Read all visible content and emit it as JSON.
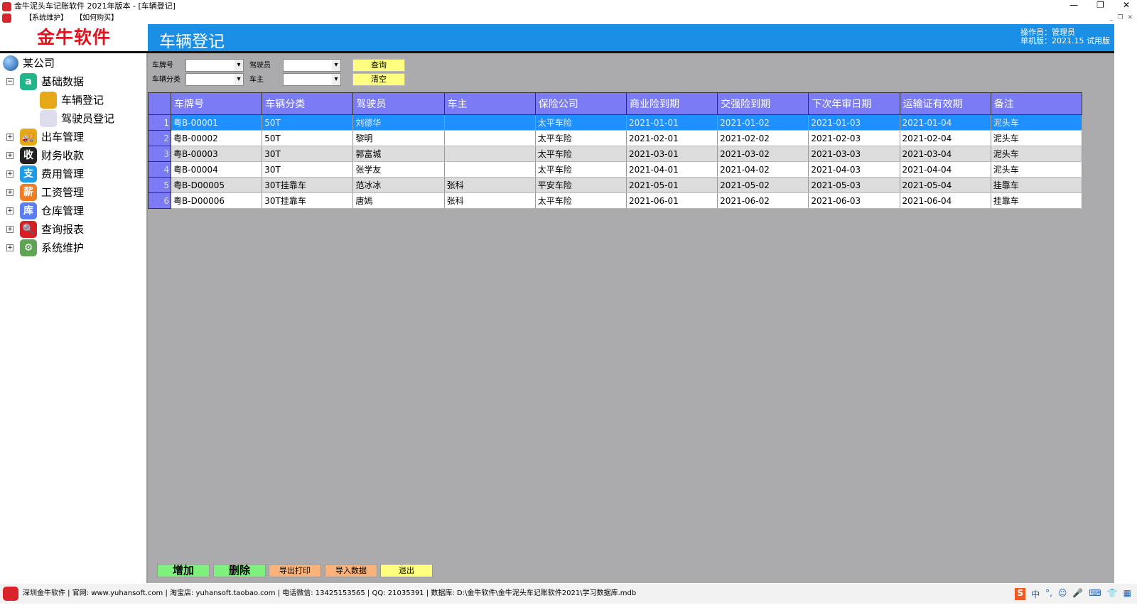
{
  "window": {
    "title": "金牛泥头车记账软件 2021年版本 - [车辆登记]",
    "controls": [
      "—",
      "❐",
      "✕"
    ],
    "mdi_controls": [
      "_",
      "❐",
      "✕"
    ]
  },
  "menu": [
    "【系统维护】",
    "【如何购买】"
  ],
  "logo": "金牛软件",
  "header": {
    "title": "车辆登记",
    "operator": "操作员：管理员",
    "version": "单机版：2021.15 试用版"
  },
  "sidebar": {
    "root": "某公司",
    "groups": [
      {
        "label": "基础数据",
        "expanded": true,
        "icon_text": "a",
        "color": "#20b58a",
        "children": [
          "车辆登记",
          "驾驶员登记"
        ]
      },
      {
        "label": "出车管理",
        "icon_text": "🚚",
        "color": "#e6a817"
      },
      {
        "label": "财务收款",
        "icon_text": "收",
        "color": "#222"
      },
      {
        "label": "费用管理",
        "icon_text": "支",
        "color": "#1e9be6"
      },
      {
        "label": "工资管理",
        "icon_text": "薪",
        "color": "#ef7d22"
      },
      {
        "label": "仓库管理",
        "icon_text": "库",
        "color": "#5b7ff2"
      },
      {
        "label": "查询报表",
        "icon_text": "🔍",
        "color": "#d71f26"
      },
      {
        "label": "系统维护",
        "icon_text": "⚙",
        "color": "#5ea454"
      }
    ]
  },
  "filters": {
    "plate": "车牌号",
    "category": "车辆分类",
    "driver": "驾驶员",
    "owner": "车主",
    "query": "查询",
    "clear": "清空"
  },
  "table": {
    "columns": [
      "车牌号",
      "车辆分类",
      "驾驶员",
      "车主",
      "保险公司",
      "商业险到期",
      "交强险到期",
      "下次年审日期",
      "运输证有效期",
      "备注"
    ],
    "rows": [
      [
        "1",
        "粤B-00001",
        "50T",
        "刘德华",
        "",
        "太平车险",
        "2021-01-01",
        "2021-01-02",
        "2021-01-03",
        "2021-01-04",
        "泥头车"
      ],
      [
        "2",
        "粤B-00002",
        "50T",
        "黎明",
        "",
        "太平车险",
        "2021-02-01",
        "2021-02-02",
        "2021-02-03",
        "2021-02-04",
        "泥头车"
      ],
      [
        "3",
        "粤B-00003",
        "30T",
        "郭富城",
        "",
        "太平车险",
        "2021-03-01",
        "2021-03-02",
        "2021-03-03",
        "2021-03-04",
        "泥头车"
      ],
      [
        "4",
        "粤B-00004",
        "30T",
        "张学友",
        "",
        "太平车险",
        "2021-04-01",
        "2021-04-02",
        "2021-04-03",
        "2021-04-04",
        "泥头车"
      ],
      [
        "5",
        "粤B-D00005",
        "30T挂靠车",
        "范冰冰",
        "张科",
        "平安车险",
        "2021-05-01",
        "2021-05-02",
        "2021-05-03",
        "2021-05-04",
        "挂靠车"
      ],
      [
        "6",
        "粤B-D00006",
        "30T挂靠车",
        "唐嫣",
        "张科",
        "太平车险",
        "2021-06-01",
        "2021-06-02",
        "2021-06-03",
        "2021-06-04",
        "挂靠车"
      ]
    ],
    "selected_row": 0
  },
  "buttons": {
    "add": "增加",
    "delete": "删除",
    "export": "导出打印",
    "import": "导入数据",
    "exit": "退出"
  },
  "status": "深圳金牛软件 | 官网: www.yuhansoft.com | 淘宝店: yuhansoft.taobao.com | 电话微信: 13425153565 | QQ: 21035391 | 数据库: D:\\金牛软件\\金牛泥头车记账软件2021\\学习数据库.mdb",
  "tray": [
    "S",
    "中",
    "°,",
    "☺",
    "🎤",
    "⌨",
    "👕",
    "▦"
  ]
}
